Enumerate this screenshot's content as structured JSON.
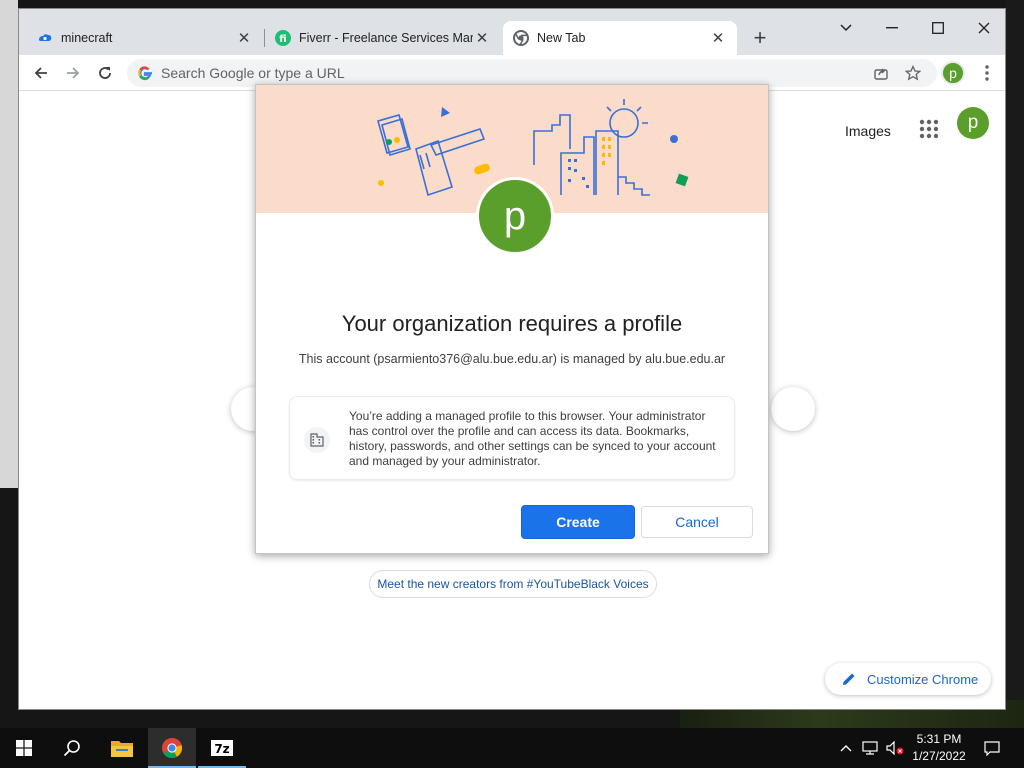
{
  "browser": {
    "tabs": [
      {
        "title": "minecraft",
        "favicon": "cloud-edu-icon",
        "active": false
      },
      {
        "title": "Fiverr - Freelance Services Marke",
        "favicon": "fiverr-icon",
        "active": false
      },
      {
        "title": "New Tab",
        "favicon": "chrome-icon",
        "active": true
      }
    ],
    "omnibox": {
      "placeholder": "Search Google or type a URL",
      "value": ""
    },
    "profile_initial": "p"
  },
  "ntp": {
    "images_link": "Images",
    "profile_initial": "p",
    "promo": "Meet the new creators from #YouTubeBlack Voices",
    "customize": "Customize Chrome"
  },
  "dialog": {
    "avatar_initial": "p",
    "title": "Your organization requires a profile",
    "subtitle": "This account (psarmiento376@alu.bue.edu.ar) is managed by alu.bue.edu.ar",
    "info": "You’re adding a managed profile to this browser. Your administrator has control over the profile and can access its data. Bookmarks, history, passwords, and other settings can be synced to your account and managed by your administrator.",
    "create_label": "Create",
    "cancel_label": "Cancel"
  },
  "taskbar": {
    "time": "5:31 PM",
    "date": "1/27/2022",
    "apps": [
      "start-icon",
      "search-icon",
      "file-explorer-icon",
      "chrome-icon",
      "7zip-icon"
    ]
  },
  "colors": {
    "accent": "#1a73e8",
    "avatar": "#5a9e2b",
    "banner": "#fbdccb"
  }
}
